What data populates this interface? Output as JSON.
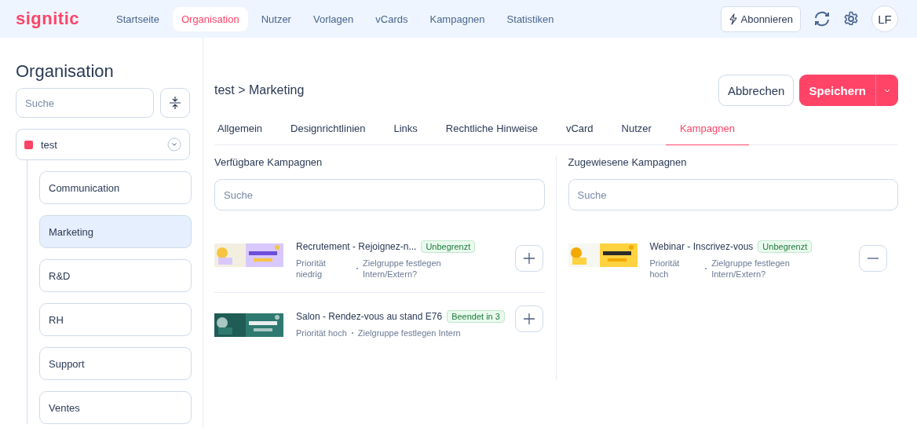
{
  "logo": "signitic",
  "nav": [
    {
      "label": "Startseite",
      "selected": false
    },
    {
      "label": "Organisation",
      "selected": true
    },
    {
      "label": "Nutzer",
      "selected": false
    },
    {
      "label": "Vorlagen",
      "selected": false
    },
    {
      "label": "vCards",
      "selected": false
    },
    {
      "label": "Kampagnen",
      "selected": false
    },
    {
      "label": "Statistiken",
      "selected": false
    }
  ],
  "subscribe_button": "Abonnieren",
  "avatar": "LF",
  "sidebar": {
    "title": "Organisation",
    "search": {
      "placeholder": "Suche"
    },
    "tree": [
      {
        "label": "test",
        "color": "#ff4468",
        "expanded": true,
        "selected": false,
        "children": [
          {
            "label": "Communication",
            "selected": false
          },
          {
            "label": "Marketing",
            "selected": true
          },
          {
            "label": "R&D",
            "selected": false
          },
          {
            "label": "RH",
            "selected": false
          },
          {
            "label": "Support",
            "selected": false
          },
          {
            "label": "Ventes",
            "selected": false
          }
        ]
      }
    ]
  },
  "breadcrumb": "test > Marketing",
  "cancel_button": "Abbrechen",
  "save_button": "Speichern",
  "tabs": [
    {
      "label": "Allgemein",
      "selected": false
    },
    {
      "label": "Designrichtlinien",
      "selected": false
    },
    {
      "label": "Links",
      "selected": false
    },
    {
      "label": "Rechtliche Hinweise",
      "selected": false
    },
    {
      "label": "vCard",
      "selected": false
    },
    {
      "label": "Nutzer",
      "selected": false
    },
    {
      "label": "Kampagnen",
      "selected": true
    }
  ],
  "available": {
    "title": "Verfügbare Kampagnen",
    "search": {
      "placeholder": "Suche"
    },
    "campaigns": [
      {
        "kind": "light",
        "name": "Recrutement - Rejoignez-n...",
        "badge": "Unbegrenzt",
        "priority": "Priorität niedrig",
        "target": "Zielgruppe festlegen Intern/Extern?"
      },
      {
        "kind": "dark",
        "name": "Salon - Rendez-vous au stand E76",
        "badge": "Beendet in 3",
        "priority": "Priorität hoch",
        "target": "Zielgruppe festlegen Intern"
      }
    ]
  },
  "assigned": {
    "title": "Zugewiesene Kampagnen",
    "search": {
      "placeholder": "Suche"
    },
    "campaigns": [
      {
        "kind": "yellow",
        "name": "Webinar - Inscrivez-vous",
        "badge": "Unbegrenzt",
        "priority": "Priorität hoch",
        "target": "Zielgruppe festlegen Intern/Extern?"
      }
    ]
  }
}
